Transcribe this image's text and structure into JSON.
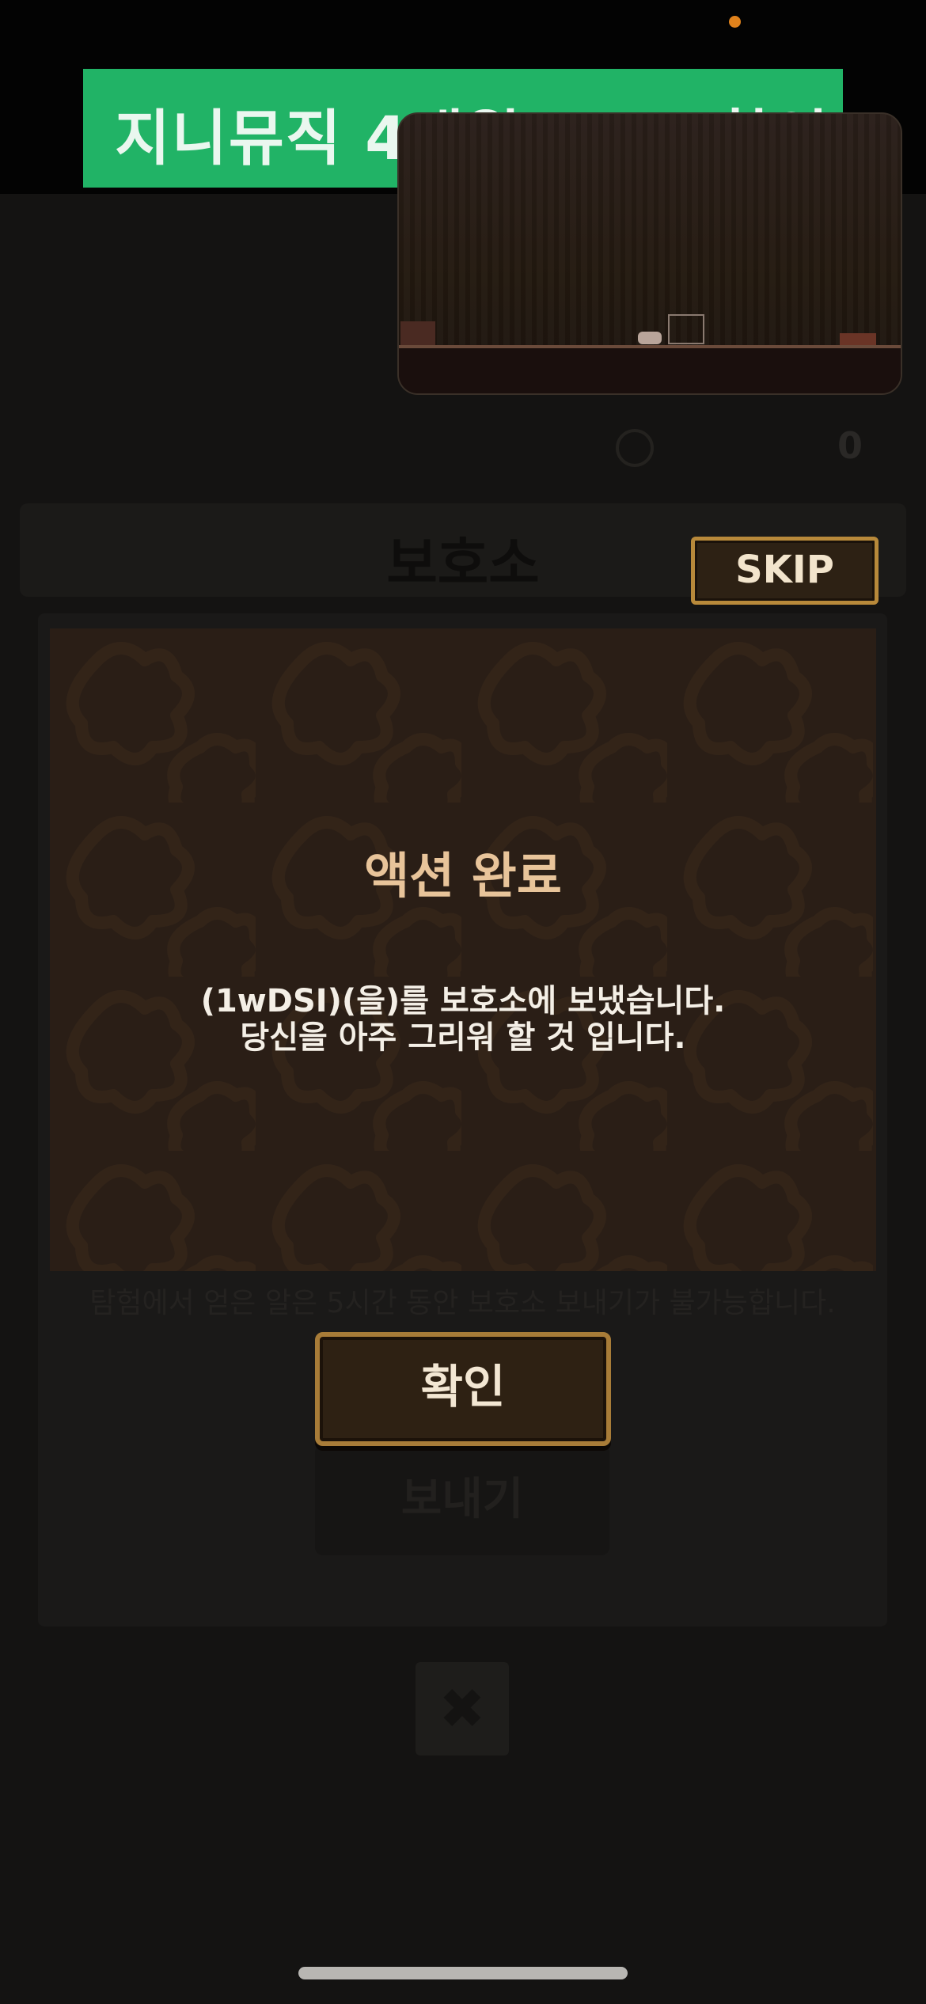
{
  "ad_banner": {
    "text": "지니뮤직 4개월 45% 할인"
  },
  "background": {
    "coin_count": "0",
    "header_title": "보호소",
    "note": "탐험에서 얻은 알은 5시간 동안 보호소 보내기가 불가능합니다.",
    "send_label": "보내기",
    "close_symbol": "✖"
  },
  "skip": {
    "label": "SKIP"
  },
  "modal": {
    "title": "액션 완료",
    "message_line1": "(1wDSI)(을)를 보호소에 보냈습니다.",
    "message_line2": "당신을 아주 그리워 할 것 입니다."
  },
  "confirm": {
    "label": "확인"
  },
  "colors": {
    "ad_green": "#21b366",
    "modal_bg": "#2a1e16",
    "title_gold": "#e8c49a",
    "button_border": "#a87c38",
    "recording_dot": "#e0821c"
  }
}
